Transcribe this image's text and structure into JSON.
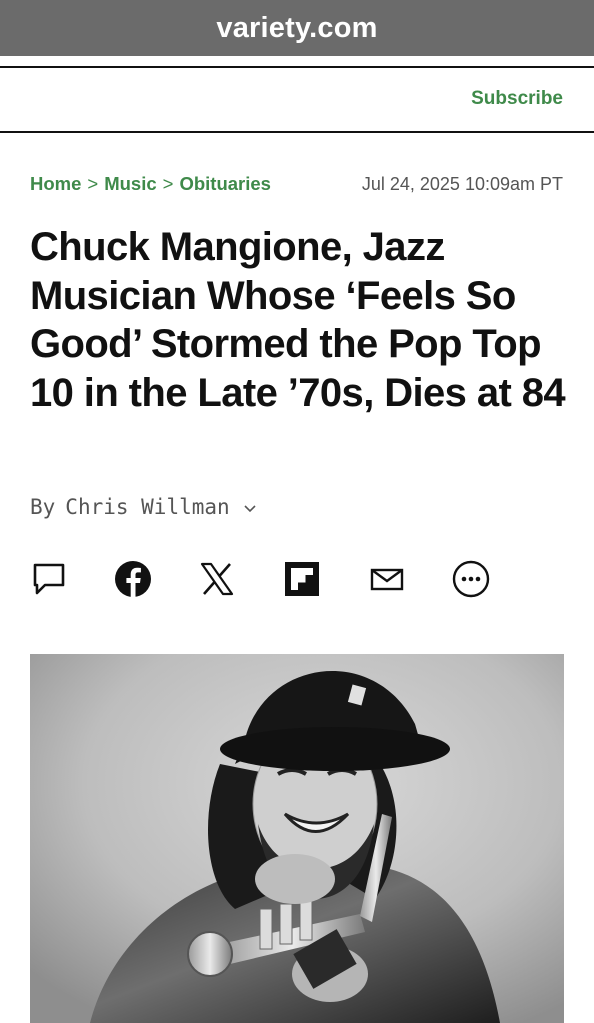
{
  "browser": {
    "url": "variety.com"
  },
  "header": {
    "subscribe_label": "Subscribe"
  },
  "breadcrumb": {
    "home": "Home",
    "music": "Music",
    "obituaries": "Obituaries",
    "separator": ">"
  },
  "article": {
    "date": "Jul 24, 2025 10:09am PT",
    "headline": "Chuck Mangione, Jazz Musician Whose ‘Feels So Good’ Stormed the Pop Top 10 in the Late ’70s, Dies at 84",
    "byline_prefix": "By",
    "author": "Chris Willman",
    "hero_image_icon": "photo-of-musician-with-flugelhorn"
  },
  "share": {
    "icons": [
      "comment-icon",
      "facebook-icon",
      "x-icon",
      "flipboard-icon",
      "email-icon",
      "more-icon"
    ]
  },
  "colors": {
    "accent_green": "#3f8a4a",
    "url_bar": "#6b6b6b",
    "text": "#111111",
    "muted": "#555555"
  }
}
